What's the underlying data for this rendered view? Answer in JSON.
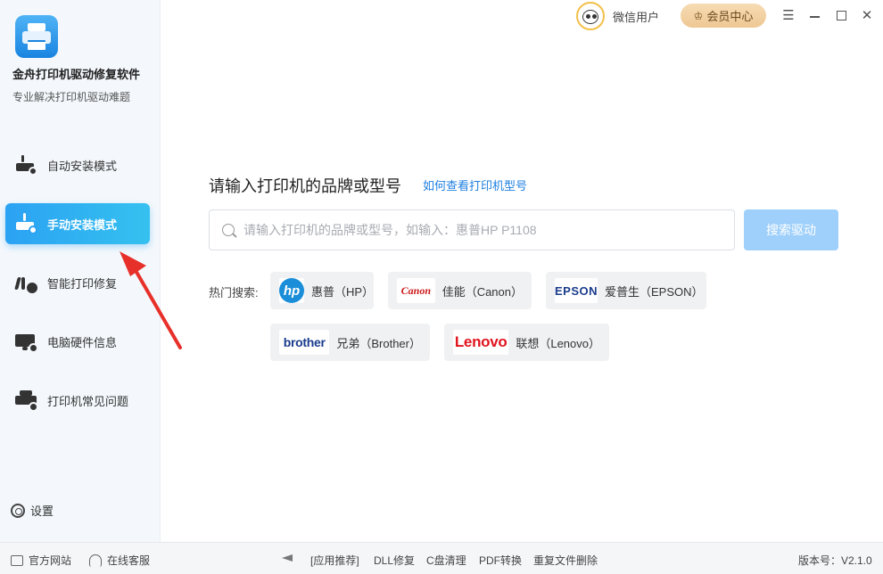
{
  "app": {
    "name": "金舟打印机驱动修复软件",
    "subtitle": "专业解决打印机驱动难题"
  },
  "sidebar": {
    "items": [
      {
        "label": "自动安装模式",
        "icon": "printer-gear-icon",
        "active": false
      },
      {
        "label": "手动安装模式",
        "icon": "printer-download-icon",
        "active": true
      },
      {
        "label": "智能打印修复",
        "icon": "printer-repair-icon",
        "active": false
      },
      {
        "label": "电脑硬件信息",
        "icon": "monitor-info-icon",
        "active": false
      },
      {
        "label": "打印机常见问题",
        "icon": "printer-question-icon",
        "active": false
      }
    ],
    "settings_label": "设置"
  },
  "topbar": {
    "user_name": "微信用户",
    "vip_label": "会员中心"
  },
  "main": {
    "title": "请输入打印机的品牌或型号",
    "help_link": "如何查看打印机型号",
    "search_placeholder": "请输入打印机的品牌或型号，如输入：惠普HP P1108",
    "search_button": "搜索驱动",
    "hot_label": "热门搜索:",
    "brands": [
      {
        "logo": "hp",
        "label": "惠普（HP）"
      },
      {
        "logo": "Canon",
        "label": "佳能（Canon）"
      },
      {
        "logo": "EPSON",
        "label": "爱普生（EPSON）"
      },
      {
        "logo": "brother",
        "label": "兄弟（Brother）"
      },
      {
        "logo": "Lenovo",
        "label": "联想（Lenovo）"
      }
    ]
  },
  "footer": {
    "website": "官方网站",
    "support": "在线客服",
    "links": [
      "[应用推荐]",
      "DLL修复",
      "C盘清理",
      "PDF转换",
      "重复文件删除"
    ],
    "version": "版本号：V2.1.0"
  },
  "colors": {
    "accent": "#2ba2f3",
    "search_button": "#9fd0fb",
    "link": "#1f7fe0",
    "vip_gold": "#eec793",
    "arrow_red": "#e8302a"
  }
}
